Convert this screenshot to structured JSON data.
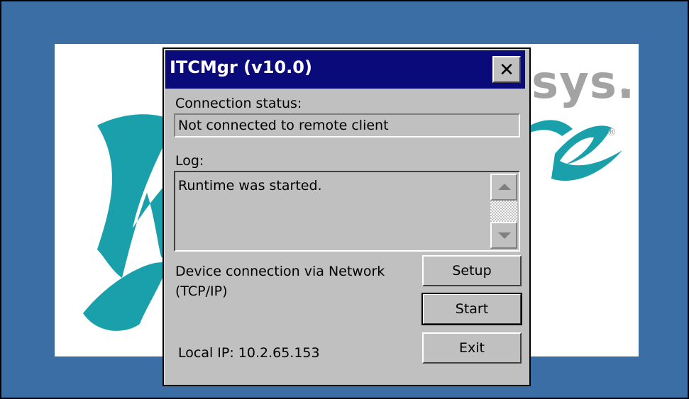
{
  "colors": {
    "desktop": "#3a6ea5",
    "titlebar": "#0a0a7a",
    "dialog_face": "#c0c0c0",
    "logo_teal": "#1aa0ab",
    "logo_gray": "#a3a3a3"
  },
  "splash": {
    "brand_text": "sys.",
    "registered_mark": "®"
  },
  "dialog": {
    "title": "ITCMgr (v10.0)",
    "close_glyph": "✕",
    "connection_status_label": "Connection status:",
    "connection_status_value": "Not connected to remote client",
    "log_label": "Log:",
    "log_lines": [
      "Runtime was started."
    ],
    "device_connection_text": "Device connection via Network (TCP/IP)",
    "local_ip_text": "Local IP: 10.2.65.153",
    "buttons": {
      "setup": "Setup",
      "start": "Start",
      "exit": "Exit"
    }
  },
  "icons": {
    "close": "close-icon",
    "scroll_up": "arrow-up-icon",
    "scroll_down": "arrow-down-icon"
  }
}
